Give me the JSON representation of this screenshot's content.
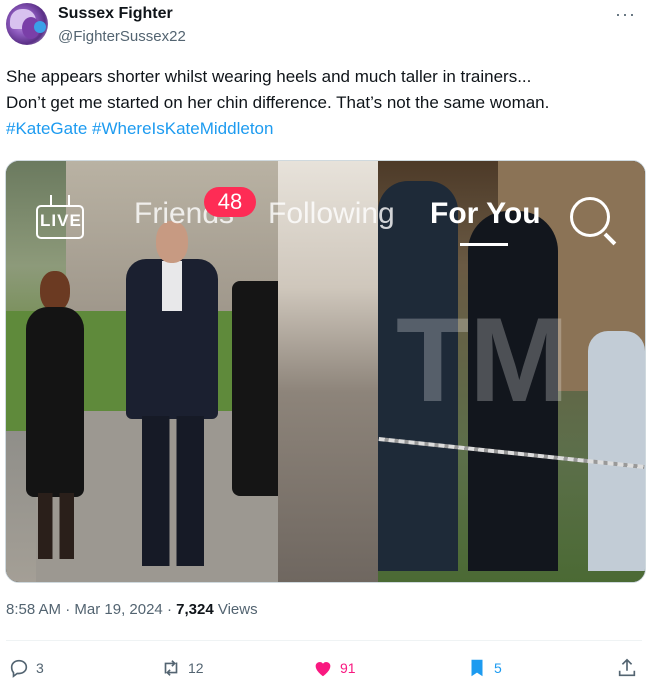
{
  "tweet": {
    "display_name": "Sussex Fighter",
    "handle": "@FighterSussex22",
    "more_label": "···",
    "text_line1": "She appears shorter whilst wearing heels and much taller in trainers...",
    "text_line2": "Don’t get me started on her chin difference. That’s not the same woman.",
    "hashtags": [
      "#KateGate",
      "#WhereIsKateMiddleton"
    ]
  },
  "media": {
    "overlay": {
      "live_label": "LIVE",
      "tab_friends": "Friends",
      "friends_badge": "48",
      "tab_following": "Following",
      "tab_for_you": "For You"
    },
    "watermark": "TM"
  },
  "meta": {
    "time": "8:58 AM",
    "date": "Mar 19, 2024",
    "views_count": "7,324",
    "views_label": "Views"
  },
  "actions": {
    "replies": "3",
    "reposts": "12",
    "likes": "91",
    "bookmarks": "5"
  },
  "colors": {
    "accent": "#1d9bf0",
    "like": "#f91880",
    "badge": "#fe2c55",
    "muted": "#536471"
  }
}
